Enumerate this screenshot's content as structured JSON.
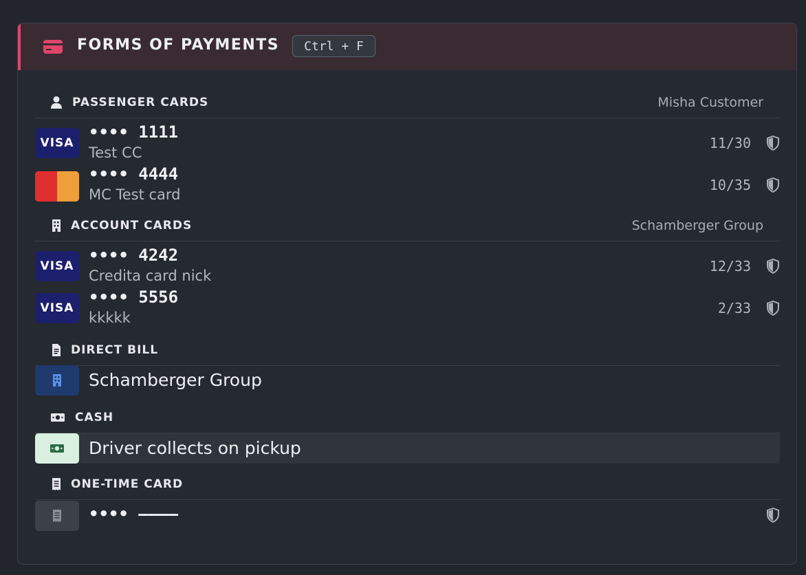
{
  "header": {
    "title": "FORMS OF PAYMENTS",
    "shortcut": "Ctrl + F",
    "icon": "credit-card-icon",
    "accent": "#e0456a"
  },
  "sections": {
    "passenger": {
      "title": "PASSENGER CARDS",
      "owner": "Misha Customer",
      "icon": "user-icon"
    },
    "account": {
      "title": "ACCOUNT CARDS",
      "owner": "Schamberger Group",
      "icon": "building-icon"
    },
    "direct": {
      "title": "DIRECT BILL",
      "icon": "document-icon"
    },
    "cash": {
      "title": "CASH",
      "icon": "cash-icon"
    },
    "onetime": {
      "title": "ONE-TIME CARD",
      "icon": "receipt-icon"
    }
  },
  "passenger_cards": [
    {
      "brand": "VISA",
      "number": "•••• 1111",
      "nick": "Test CC",
      "expiry": "11/30"
    },
    {
      "brand": "mastercard",
      "number": "•••• 4444",
      "nick": "MC Test card",
      "expiry": "10/35"
    }
  ],
  "account_cards": [
    {
      "brand": "VISA",
      "number": "•••• 4242",
      "nick": "Credita card nick",
      "expiry": "12/33"
    },
    {
      "brand": "VISA",
      "number": "•••• 5556",
      "nick": "kkkkk",
      "expiry": "2/33"
    }
  ],
  "direct_bill": {
    "name": "Schamberger Group",
    "icon": "building-icon"
  },
  "cash": {
    "label": "Driver collects on pickup",
    "icon": "cash-icon"
  },
  "one_time": {
    "number": "•••• ––––",
    "icon": "receipt-icon"
  }
}
